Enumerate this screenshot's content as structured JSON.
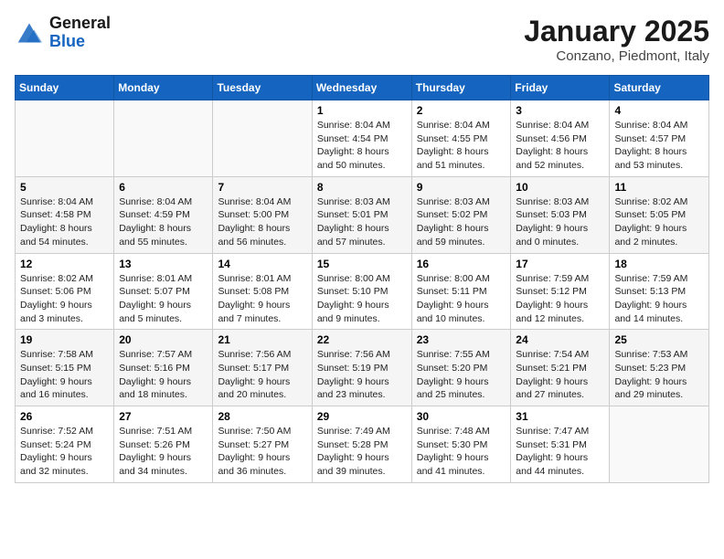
{
  "logo": {
    "text_general": "General",
    "text_blue": "Blue"
  },
  "calendar": {
    "title": "January 2025",
    "subtitle": "Conzano, Piedmont, Italy"
  },
  "headers": [
    "Sunday",
    "Monday",
    "Tuesday",
    "Wednesday",
    "Thursday",
    "Friday",
    "Saturday"
  ],
  "weeks": [
    [
      {
        "day": "",
        "info": ""
      },
      {
        "day": "",
        "info": ""
      },
      {
        "day": "",
        "info": ""
      },
      {
        "day": "1",
        "info": "Sunrise: 8:04 AM\nSunset: 4:54 PM\nDaylight: 8 hours\nand 50 minutes."
      },
      {
        "day": "2",
        "info": "Sunrise: 8:04 AM\nSunset: 4:55 PM\nDaylight: 8 hours\nand 51 minutes."
      },
      {
        "day": "3",
        "info": "Sunrise: 8:04 AM\nSunset: 4:56 PM\nDaylight: 8 hours\nand 52 minutes."
      },
      {
        "day": "4",
        "info": "Sunrise: 8:04 AM\nSunset: 4:57 PM\nDaylight: 8 hours\nand 53 minutes."
      }
    ],
    [
      {
        "day": "5",
        "info": "Sunrise: 8:04 AM\nSunset: 4:58 PM\nDaylight: 8 hours\nand 54 minutes."
      },
      {
        "day": "6",
        "info": "Sunrise: 8:04 AM\nSunset: 4:59 PM\nDaylight: 8 hours\nand 55 minutes."
      },
      {
        "day": "7",
        "info": "Sunrise: 8:04 AM\nSunset: 5:00 PM\nDaylight: 8 hours\nand 56 minutes."
      },
      {
        "day": "8",
        "info": "Sunrise: 8:03 AM\nSunset: 5:01 PM\nDaylight: 8 hours\nand 57 minutes."
      },
      {
        "day": "9",
        "info": "Sunrise: 8:03 AM\nSunset: 5:02 PM\nDaylight: 8 hours\nand 59 minutes."
      },
      {
        "day": "10",
        "info": "Sunrise: 8:03 AM\nSunset: 5:03 PM\nDaylight: 9 hours\nand 0 minutes."
      },
      {
        "day": "11",
        "info": "Sunrise: 8:02 AM\nSunset: 5:05 PM\nDaylight: 9 hours\nand 2 minutes."
      }
    ],
    [
      {
        "day": "12",
        "info": "Sunrise: 8:02 AM\nSunset: 5:06 PM\nDaylight: 9 hours\nand 3 minutes."
      },
      {
        "day": "13",
        "info": "Sunrise: 8:01 AM\nSunset: 5:07 PM\nDaylight: 9 hours\nand 5 minutes."
      },
      {
        "day": "14",
        "info": "Sunrise: 8:01 AM\nSunset: 5:08 PM\nDaylight: 9 hours\nand 7 minutes."
      },
      {
        "day": "15",
        "info": "Sunrise: 8:00 AM\nSunset: 5:10 PM\nDaylight: 9 hours\nand 9 minutes."
      },
      {
        "day": "16",
        "info": "Sunrise: 8:00 AM\nSunset: 5:11 PM\nDaylight: 9 hours\nand 10 minutes."
      },
      {
        "day": "17",
        "info": "Sunrise: 7:59 AM\nSunset: 5:12 PM\nDaylight: 9 hours\nand 12 minutes."
      },
      {
        "day": "18",
        "info": "Sunrise: 7:59 AM\nSunset: 5:13 PM\nDaylight: 9 hours\nand 14 minutes."
      }
    ],
    [
      {
        "day": "19",
        "info": "Sunrise: 7:58 AM\nSunset: 5:15 PM\nDaylight: 9 hours\nand 16 minutes."
      },
      {
        "day": "20",
        "info": "Sunrise: 7:57 AM\nSunset: 5:16 PM\nDaylight: 9 hours\nand 18 minutes."
      },
      {
        "day": "21",
        "info": "Sunrise: 7:56 AM\nSunset: 5:17 PM\nDaylight: 9 hours\nand 20 minutes."
      },
      {
        "day": "22",
        "info": "Sunrise: 7:56 AM\nSunset: 5:19 PM\nDaylight: 9 hours\nand 23 minutes."
      },
      {
        "day": "23",
        "info": "Sunrise: 7:55 AM\nSunset: 5:20 PM\nDaylight: 9 hours\nand 25 minutes."
      },
      {
        "day": "24",
        "info": "Sunrise: 7:54 AM\nSunset: 5:21 PM\nDaylight: 9 hours\nand 27 minutes."
      },
      {
        "day": "25",
        "info": "Sunrise: 7:53 AM\nSunset: 5:23 PM\nDaylight: 9 hours\nand 29 minutes."
      }
    ],
    [
      {
        "day": "26",
        "info": "Sunrise: 7:52 AM\nSunset: 5:24 PM\nDaylight: 9 hours\nand 32 minutes."
      },
      {
        "day": "27",
        "info": "Sunrise: 7:51 AM\nSunset: 5:26 PM\nDaylight: 9 hours\nand 34 minutes."
      },
      {
        "day": "28",
        "info": "Sunrise: 7:50 AM\nSunset: 5:27 PM\nDaylight: 9 hours\nand 36 minutes."
      },
      {
        "day": "29",
        "info": "Sunrise: 7:49 AM\nSunset: 5:28 PM\nDaylight: 9 hours\nand 39 minutes."
      },
      {
        "day": "30",
        "info": "Sunrise: 7:48 AM\nSunset: 5:30 PM\nDaylight: 9 hours\nand 41 minutes."
      },
      {
        "day": "31",
        "info": "Sunrise: 7:47 AM\nSunset: 5:31 PM\nDaylight: 9 hours\nand 44 minutes."
      },
      {
        "day": "",
        "info": ""
      }
    ]
  ]
}
